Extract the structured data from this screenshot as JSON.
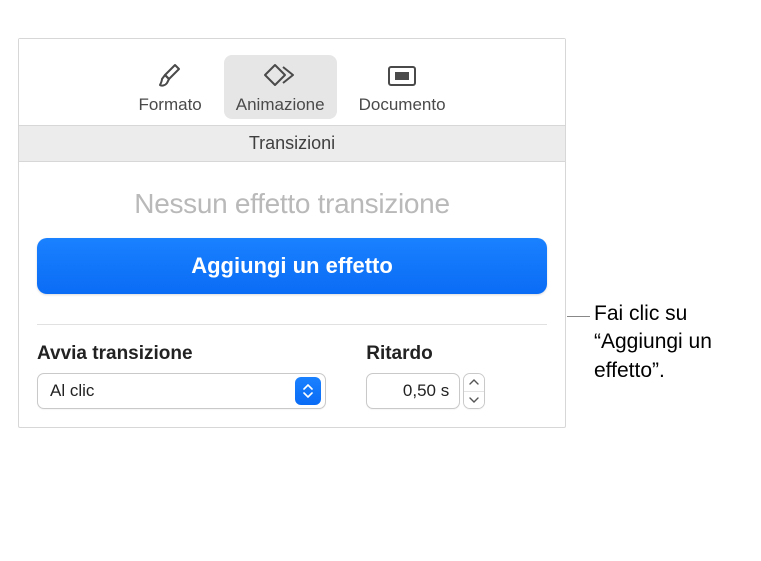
{
  "toolbar": {
    "format_label": "Formato",
    "animation_label": "Animazione",
    "document_label": "Documento"
  },
  "section": {
    "title": "Transizioni"
  },
  "panel": {
    "no_effect_text": "Nessun effetto transizione",
    "add_effect_label": "Aggiungi un effetto"
  },
  "controls": {
    "start_label": "Avvia transizione",
    "start_value": "Al clic",
    "delay_label": "Ritardo",
    "delay_value": "0,50 s"
  },
  "callout": {
    "text": "Fai clic su “Aggiungi un effetto”."
  }
}
